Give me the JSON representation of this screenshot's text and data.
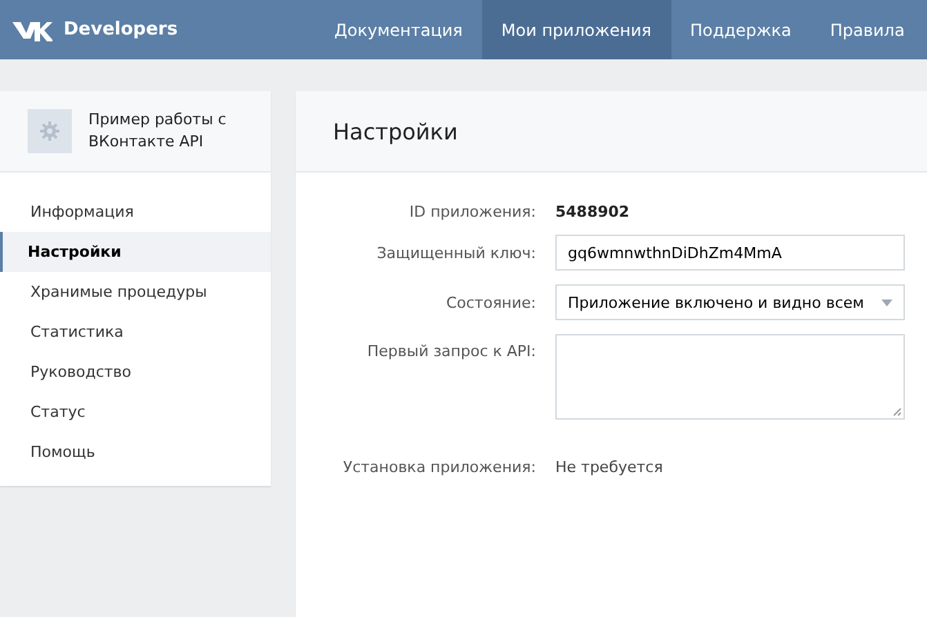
{
  "header": {
    "logo_text": "Developers",
    "nav": [
      {
        "label": "Документация",
        "selected": false
      },
      {
        "label": "Мои приложения",
        "selected": true
      },
      {
        "label": "Поддержка",
        "selected": false
      },
      {
        "label": "Правила",
        "selected": false
      }
    ]
  },
  "sidebar": {
    "app_name": "Пример работы с ВКонтакте API",
    "items": [
      {
        "label": "Информация",
        "selected": false
      },
      {
        "label": "Настройки",
        "selected": true
      },
      {
        "label": "Хранимые процедуры",
        "selected": false
      },
      {
        "label": "Статистика",
        "selected": false
      },
      {
        "label": "Руководство",
        "selected": false
      },
      {
        "label": "Статус",
        "selected": false
      },
      {
        "label": "Помощь",
        "selected": false
      }
    ]
  },
  "panel": {
    "title": "Настройки",
    "fields": [
      {
        "kind": "static",
        "label": "ID приложения:",
        "value": "5488902"
      },
      {
        "kind": "input",
        "label": "Защищенный ключ:",
        "value": "gq6wmnwthnDiDhZm4MmA"
      },
      {
        "kind": "select",
        "label": "Состояние:",
        "value": "Приложение включено и видно всем"
      },
      {
        "kind": "textarea",
        "label": "Первый запрос к API:"
      },
      {
        "kind": "note",
        "label": "Установка приложения:",
        "value": "Не требуется"
      }
    ]
  }
}
